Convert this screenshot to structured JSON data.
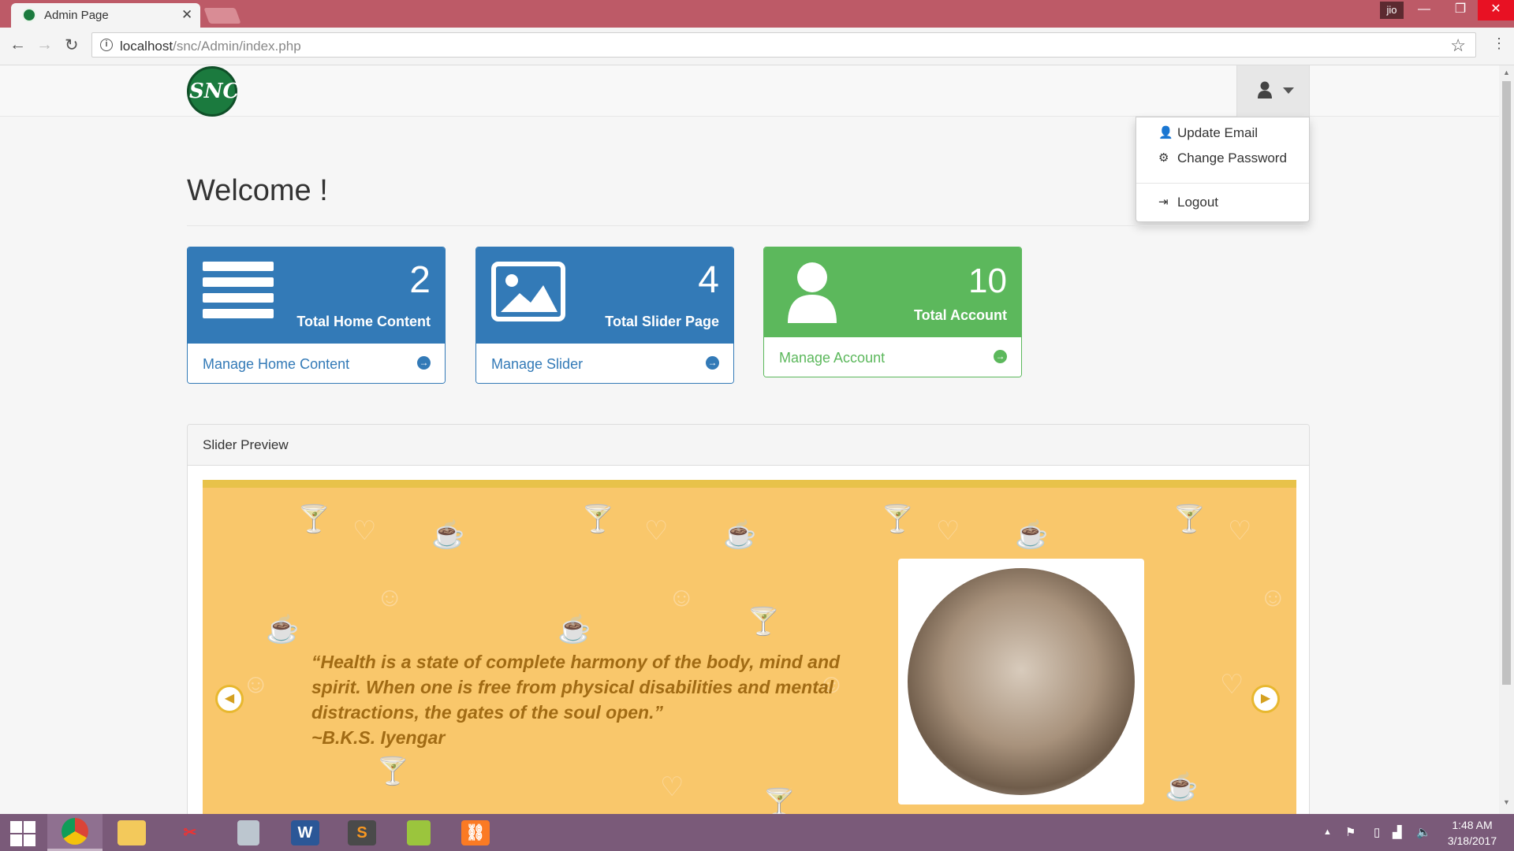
{
  "browser": {
    "tab_title": "Admin Page",
    "url_host": "localhost",
    "url_path": "/snc/Admin/index.php",
    "profile_badge": "jio"
  },
  "navbar": {
    "logo_text": "SNC",
    "user_menu": {
      "items": [
        "Update Email",
        "Change Password",
        "Logout"
      ]
    }
  },
  "main": {
    "welcome": "Welcome !",
    "cards": [
      {
        "count": "2",
        "label": "Total Home Content",
        "link": "Manage Home Content",
        "color": "#337ab7",
        "icon": "list-icon"
      },
      {
        "count": "4",
        "label": "Total Slider Page",
        "link": "Manage Slider",
        "color": "#337ab7",
        "icon": "image-icon"
      },
      {
        "count": "10",
        "label": "Total Account",
        "link": "Manage Account",
        "color": "#5cb85c",
        "icon": "user-icon"
      }
    ],
    "slider_panel": {
      "title": "Slider Preview",
      "quote": "“Health is a state of complete harmony of the body, mind and spirit. When one is free from physical disabilities and mental distractions, the gates of the soul open.”",
      "author": "~B.K.S. Iyengar",
      "background_color": "#f9c76b"
    }
  },
  "taskbar": {
    "time": "1:48 AM",
    "date": "3/18/2017",
    "apps": [
      "windows-start",
      "chrome",
      "file-explorer",
      "snipping-tool",
      "calculator",
      "word",
      "sublime-text",
      "notepad-plus",
      "xampp"
    ]
  }
}
